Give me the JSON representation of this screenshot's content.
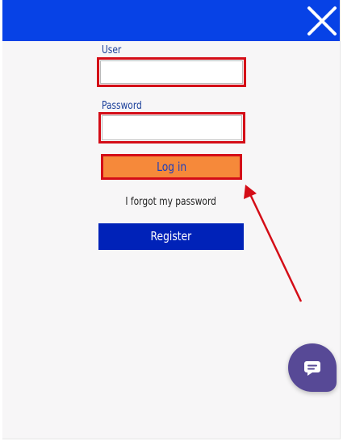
{
  "header": {
    "background_color": "#0742e6",
    "close_icon": "close-x-icon"
  },
  "form": {
    "user_label": "User",
    "user_value": "",
    "password_label": "Password",
    "password_value": "",
    "login_label": "Log in",
    "forgot_label": "I forgot my password",
    "register_label": "Register"
  },
  "colors": {
    "highlight": "#d40d17",
    "login_button": "#f6893a",
    "register_button": "#0022b8",
    "chat_button": "#574996"
  },
  "chat": {
    "icon": "chat-bubble-icon"
  },
  "annotation": {
    "type": "arrow",
    "target": "login-button"
  }
}
